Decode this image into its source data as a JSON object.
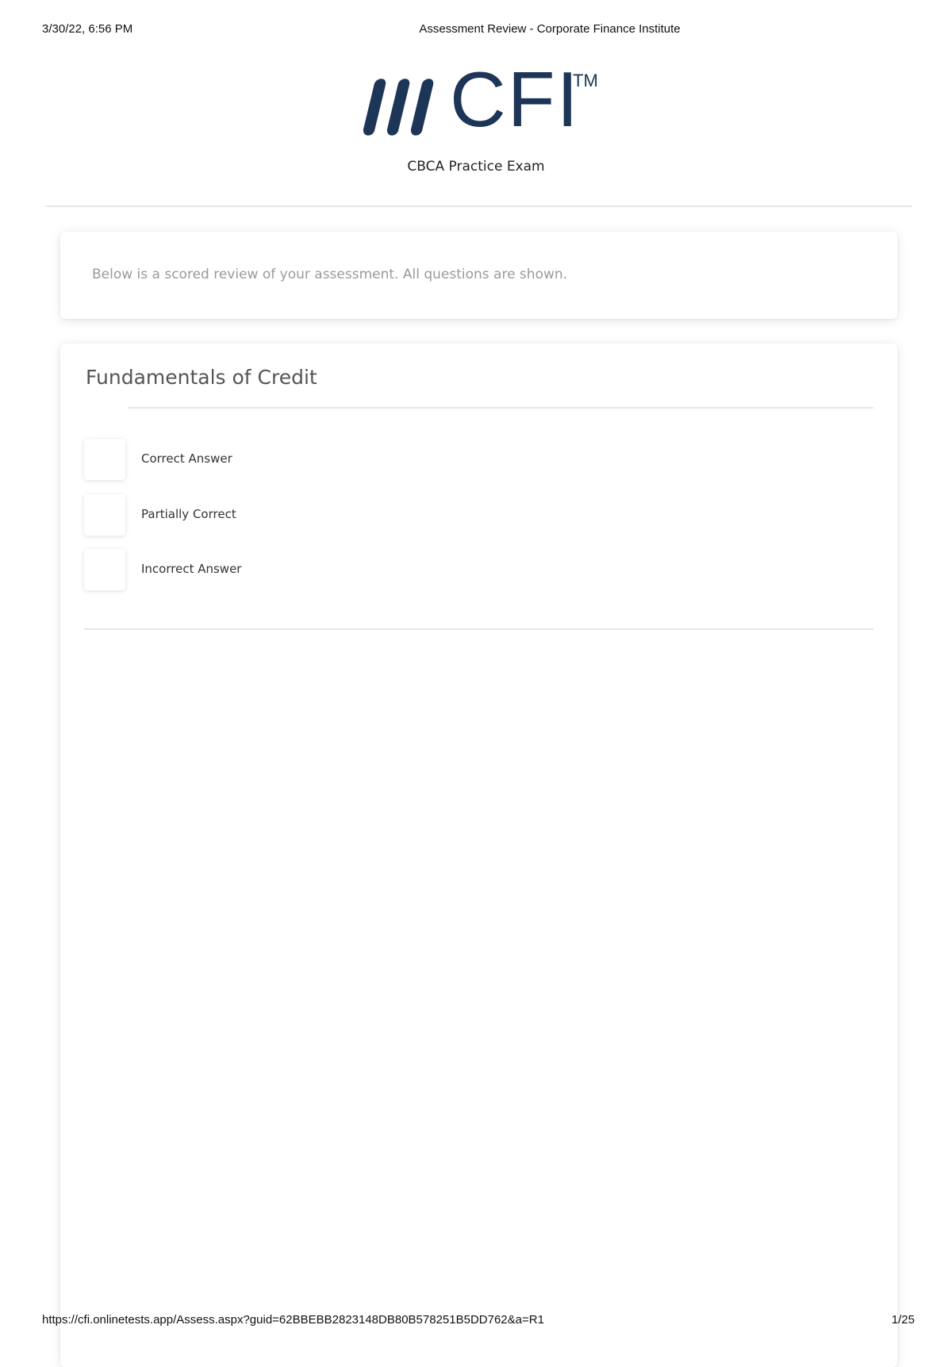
{
  "print_header": {
    "datetime": "3/30/22, 6:56 PM",
    "page_title": "Assessment Review - Corporate Finance Institute"
  },
  "brand": {
    "logo_text": "CFI",
    "trademark": "TM",
    "exam_title": "CBCA Practice Exam",
    "color": "#1d3557"
  },
  "intro": {
    "text": "Below is a scored review of your assessment. All questions are shown."
  },
  "section": {
    "title": "Fundamentals of Credit",
    "legend": [
      {
        "label": "Correct Answer"
      },
      {
        "label": "Partially Correct"
      },
      {
        "label": "Incorrect Answer"
      }
    ]
  },
  "print_footer": {
    "url": "https://cfi.onlinetests.app/Assess.aspx?guid=62BBEBB2823148DB80B578251B5DD762&a=R1",
    "page": "1/25"
  }
}
